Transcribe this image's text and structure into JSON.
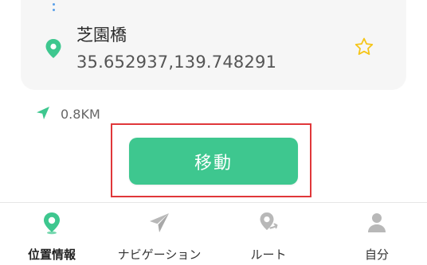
{
  "location": {
    "name": "芝園橋",
    "coordinates": "35.652937,139.748291",
    "icon": "location-pin-icon",
    "favorite_icon": "star-outline-icon"
  },
  "distance": {
    "value": "0.8KM",
    "icon": "navigation-arrow-icon"
  },
  "actions": {
    "move_label": "移動"
  },
  "bottom_nav": {
    "items": [
      {
        "label": "位置情報",
        "icon": "location-pin-icon",
        "active": true
      },
      {
        "label": "ナビゲーション",
        "icon": "paper-plane-icon",
        "active": false
      },
      {
        "label": "ルート",
        "icon": "route-pin-icon",
        "active": false
      },
      {
        "label": "自分",
        "icon": "person-icon",
        "active": false
      }
    ]
  },
  "colors": {
    "accent": "#3ec78f",
    "highlight": "#e0373a",
    "favorite": "#f5c518",
    "inactive_icon": "#b8b8b8"
  }
}
